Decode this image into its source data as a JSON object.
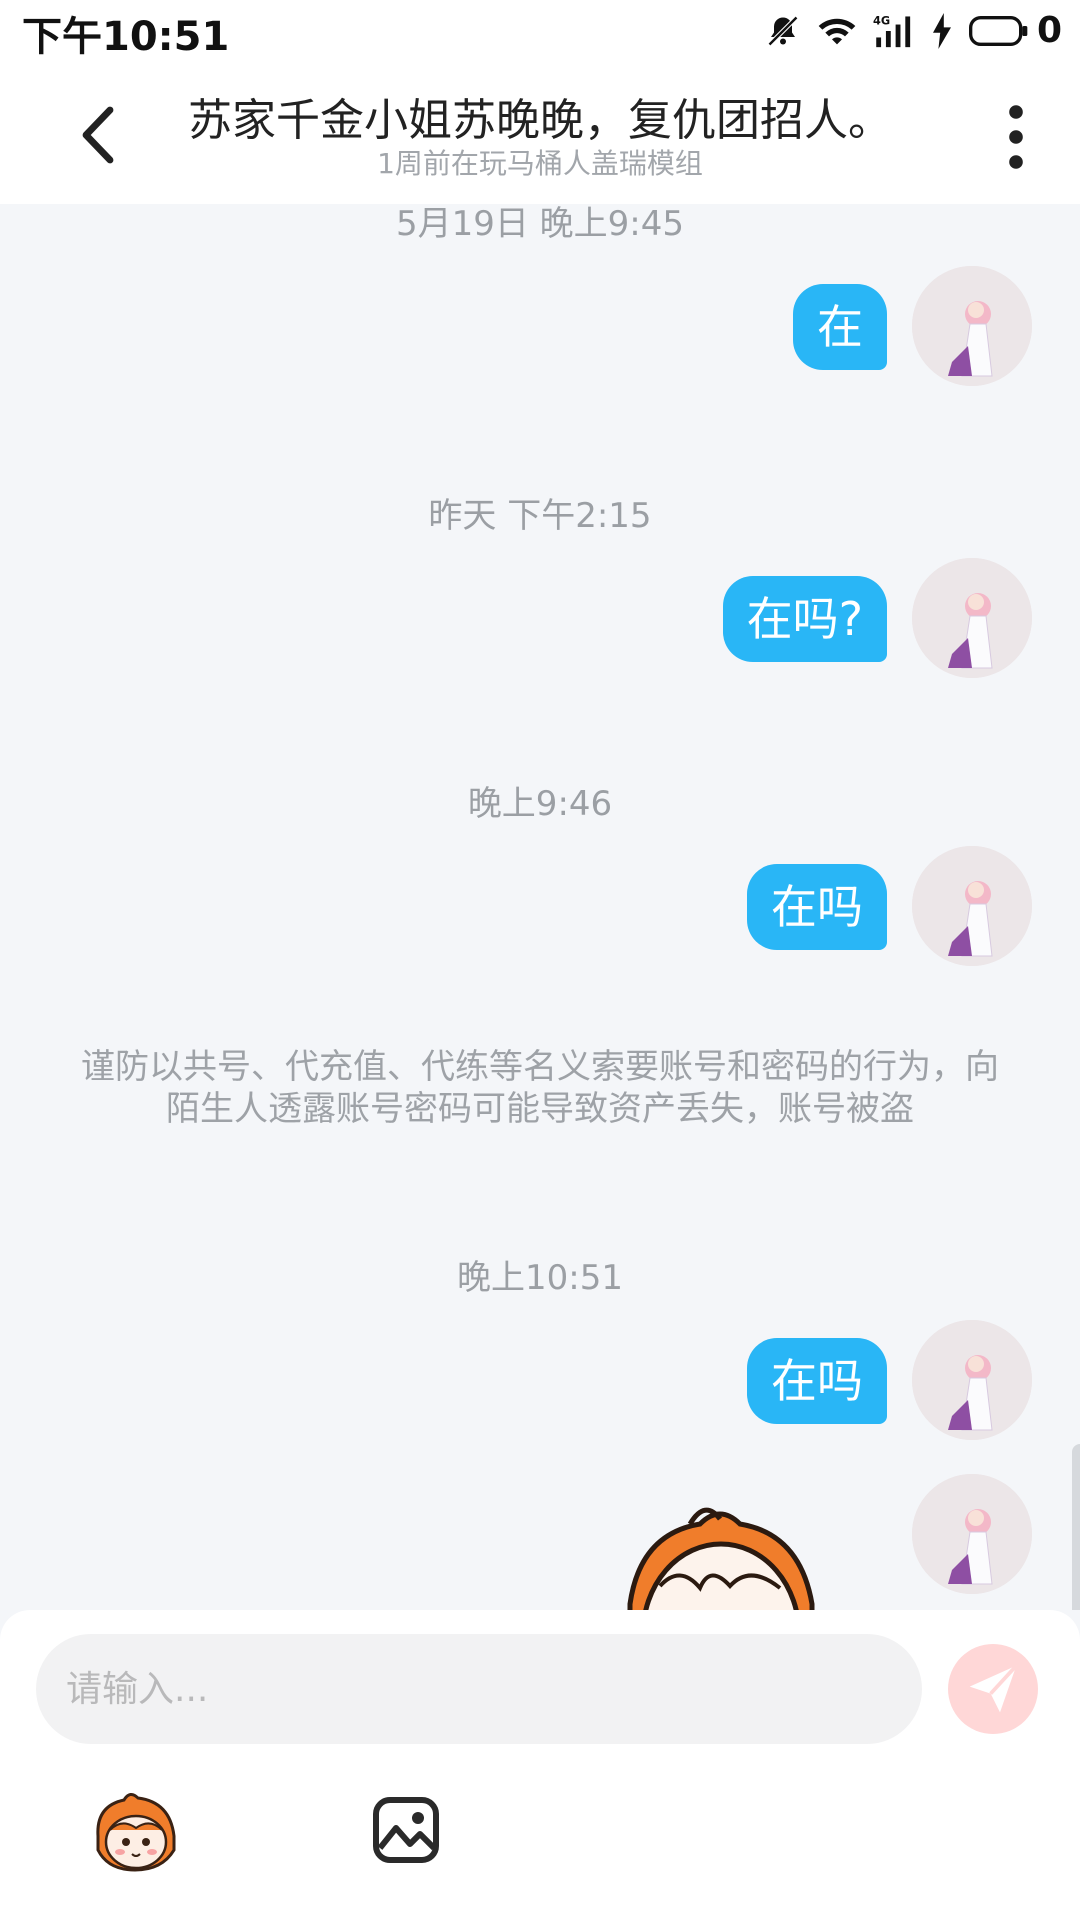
{
  "status_bar": {
    "time": "下午10:51",
    "battery_level": "0",
    "network": "4G",
    "icons": [
      "mute-icon",
      "wifi-icon",
      "signal-icon",
      "charging-icon",
      "battery-icon"
    ]
  },
  "header": {
    "title": "苏家千金小姐苏晚晚，复仇团招人。",
    "subtitle": "1周前在玩马桶人盖瑞模组",
    "back_icon": "chevron-left-icon",
    "more_icon": "more-vertical-icon"
  },
  "messages": [
    {
      "timestamp": "5月19日 晚上9:45",
      "text": "在"
    },
    {
      "timestamp": "昨天 下午2:15",
      "text": "在吗?"
    },
    {
      "timestamp": "晚上9:46",
      "text": "在吗"
    },
    {
      "timestamp": "晚上10:51",
      "text": "在吗"
    }
  ],
  "notice": "谨防以共号、代充值、代练等名义索要账号和密码的行为，向陌生人透露账号密码可能导致资产丢失，账号被盗",
  "composer": {
    "placeholder": "请输入...",
    "send_icon": "send-icon",
    "emoji_icon": "emoji-sticker-icon",
    "image_icon": "image-icon"
  },
  "colors": {
    "accent": "#29b6f6",
    "background": "#f4f6f9",
    "send_disabled": "#ffd7d7"
  }
}
